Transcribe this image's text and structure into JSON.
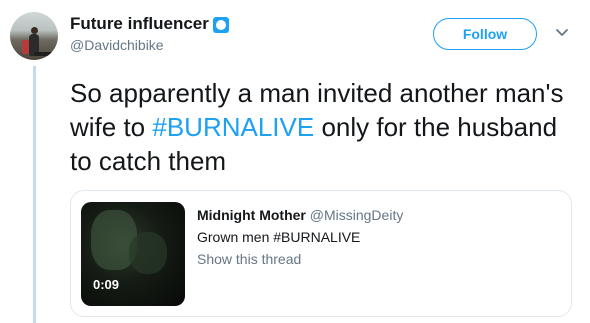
{
  "author": {
    "display_name": "Future influencer",
    "handle": "@Davidchibike",
    "avatar_icon": "avatar-photo",
    "verified_icon": "badge-icon"
  },
  "actions": {
    "follow_label": "Follow",
    "more_icon": "chevron-down-icon"
  },
  "tweet": {
    "text_before": "So apparently a man invited another man's wife to ",
    "hashtag": "#BURNALIVE",
    "text_after": " only for the husband to catch them"
  },
  "quoted_tweet": {
    "display_name": "Midnight Mother",
    "handle": "@MissingDeity",
    "text": "Grown men #BURNALIVE",
    "thread_link": "Show this thread",
    "video_duration": "0:09"
  },
  "colors": {
    "accent": "#1da1f2",
    "thread_line": "#c4dbeb",
    "secondary_text": "#657786"
  }
}
